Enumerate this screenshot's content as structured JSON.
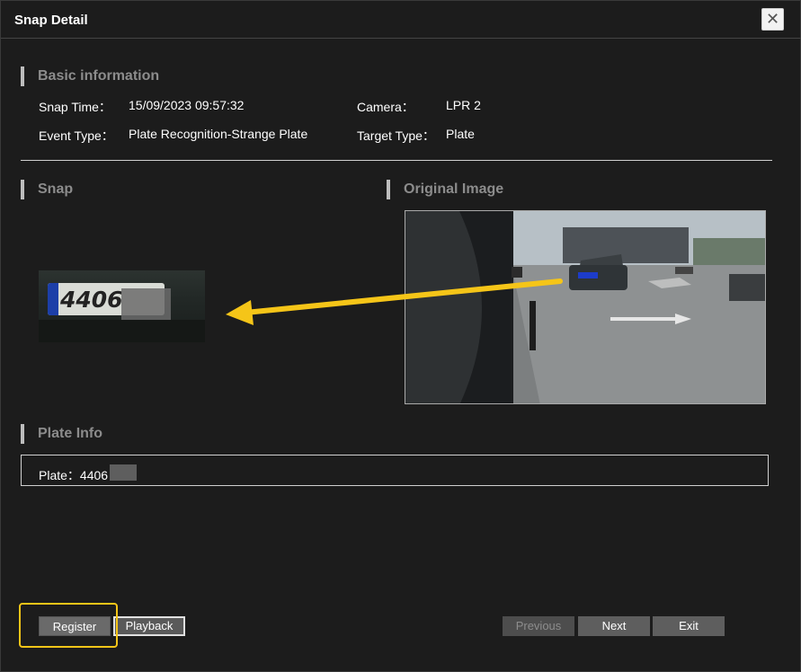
{
  "dialog": {
    "title": "Snap Detail",
    "close_glyph": "✕"
  },
  "basic": {
    "heading": "Basic information",
    "snap_time_label": "Snap Time：",
    "snap_time_value": "15/09/2023 09:57:32",
    "camera_label": "Camera：",
    "camera_value": "LPR 2",
    "event_type_label": "Event Type：",
    "event_type_value": "Plate Recognition-Strange Plate",
    "target_type_label": "Target Type：",
    "target_type_value": "Plate"
  },
  "snap": {
    "heading": "Snap",
    "plate_text": "4406"
  },
  "original": {
    "heading": "Original Image"
  },
  "plate_info": {
    "heading": "Plate Info",
    "label": "Plate：4406"
  },
  "buttons": {
    "register": "Register",
    "playback": "Playback",
    "previous": "Previous",
    "next": "Next",
    "exit": "Exit"
  },
  "colors": {
    "annotation": "#f5c518",
    "background": "#1c1c1c",
    "heading": "#8c8c8c"
  },
  "icons": {
    "close": "close-icon"
  }
}
